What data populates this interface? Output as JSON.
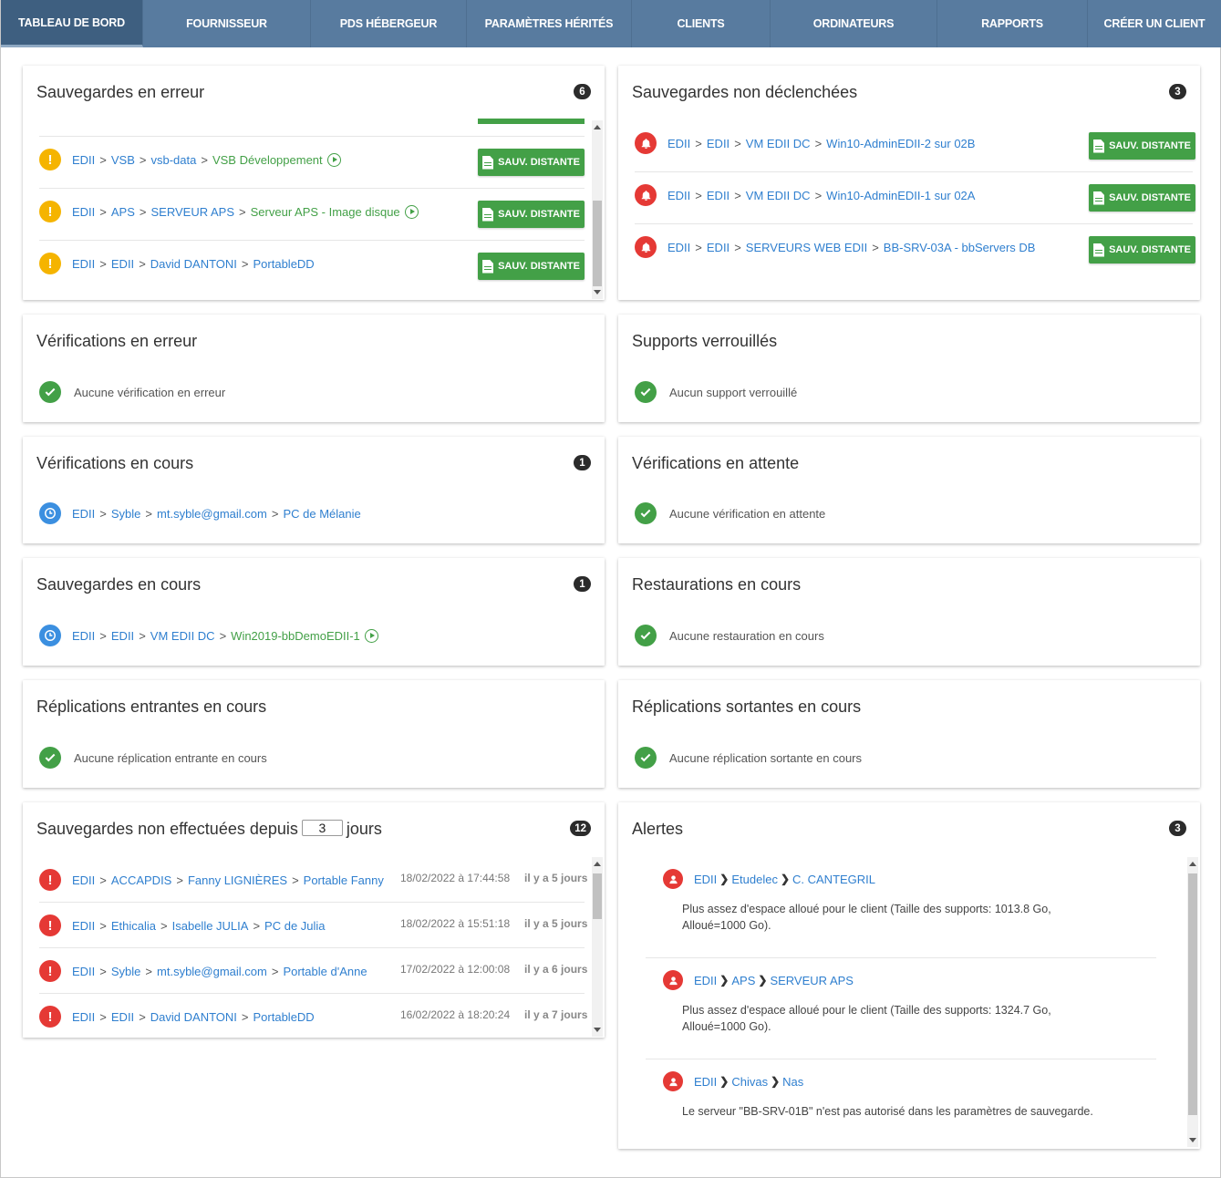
{
  "nav": {
    "tabs": [
      {
        "label": "TABLEAU DE BORD"
      },
      {
        "label": "FOURNISSEUR"
      },
      {
        "label": "PDS HÉBERGEUR"
      },
      {
        "label": "PARAMÈTRES HÉRITÉS"
      },
      {
        "label": "CLIENTS"
      },
      {
        "label": "ORDINATEURS"
      },
      {
        "label": "RAPPORTS"
      },
      {
        "label": "CRÉER UN CLIENT"
      }
    ]
  },
  "icons": {
    "warning": "warning-icon",
    "error": "error-icon",
    "ok": "check-icon",
    "clock": "clock-icon",
    "bell": "bell-icon",
    "user": "user-icon",
    "document": "document-icon",
    "play": "play-icon"
  },
  "colors": {
    "nav_bg": "#587b9f",
    "green": "#43a047",
    "red": "#e53935",
    "orange": "#f5b400",
    "blue": "#3b8fe0",
    "link": "#2f7fcf"
  },
  "sep": ">",
  "remote_button_label": "SAUV. DISTANTE",
  "backup_errors": {
    "title": "Sauvegardes en erreur",
    "count": "6",
    "rows": [
      {
        "p": [
          "EDII",
          "VSB",
          "vsb-data"
        ],
        "last": "VSB Développement"
      },
      {
        "p": [
          "EDII",
          "APS",
          "SERVEUR APS"
        ],
        "last": "Serveur APS - Image disque"
      },
      {
        "p": [
          "EDII",
          "EDII",
          "David DANTONI"
        ],
        "last": "PortableDD"
      }
    ]
  },
  "backups_not_started": {
    "title": "Sauvegardes non déclenchées",
    "count": "3",
    "rows": [
      {
        "p": [
          "EDII",
          "EDII",
          "VM EDII DC"
        ],
        "last": "Win10-AdminEDII-2 sur 02B"
      },
      {
        "p": [
          "EDII",
          "EDII",
          "VM EDII DC"
        ],
        "last": "Win10-AdminEDII-1 sur 02A"
      },
      {
        "p": [
          "EDII",
          "EDII",
          "SERVEURS WEB EDII"
        ],
        "last": "BB-SRV-03A - bbServers DB"
      }
    ]
  },
  "checks_error": {
    "title": "Vérifications en erreur",
    "empty": "Aucune vérification en erreur"
  },
  "locked_media": {
    "title": "Supports verrouillés",
    "empty": "Aucun support verrouillé"
  },
  "checks_running": {
    "title": "Vérifications en cours",
    "count": "1",
    "row": {
      "p": [
        "EDII",
        "Syble",
        "mt.syble@gmail.com"
      ],
      "last": "PC de Mélanie"
    }
  },
  "checks_pending": {
    "title": "Vérifications en attente",
    "empty": "Aucune vérification en attente"
  },
  "backups_running": {
    "title": "Sauvegardes en cours",
    "count": "1",
    "row": {
      "p": [
        "EDII",
        "EDII",
        "VM EDII DC"
      ],
      "last": "Win2019-bbDemoEDII-1"
    }
  },
  "restores_running": {
    "title": "Restaurations en cours",
    "empty": "Aucune restauration en cours"
  },
  "replications_in": {
    "title": "Réplications entrantes en cours",
    "empty": "Aucune réplication entrante en cours"
  },
  "replications_out": {
    "title": "Réplications sortantes en cours",
    "empty": "Aucune réplication sortante en cours"
  },
  "backups_missed": {
    "title_before": "Sauvegardes non effectuées depuis",
    "days": "3",
    "title_after": "jours",
    "count": "12",
    "rows": [
      {
        "p": [
          "EDII",
          "ACCAPDIS",
          "Fanny LIGNIÈRES"
        ],
        "last": "Portable Fanny",
        "date": "18/02/2022 à 17:44:58",
        "ago": "il y a 5 jours"
      },
      {
        "p": [
          "EDII",
          "Ethicalia",
          "Isabelle JULIA"
        ],
        "last": "PC de Julia",
        "date": "18/02/2022 à 15:51:18",
        "ago": "il y a 5 jours"
      },
      {
        "p": [
          "EDII",
          "Syble",
          "mt.syble@gmail.com"
        ],
        "last": "Portable d'Anne",
        "date": "17/02/2022 à 12:00:08",
        "ago": "il y a 6 jours"
      },
      {
        "p": [
          "EDII",
          "EDII",
          "David DANTONI"
        ],
        "last": "PortableDD",
        "date": "16/02/2022 à 18:20:24",
        "ago": "il y a 7 jours"
      }
    ]
  },
  "alerts": {
    "title": "Alertes",
    "count": "3",
    "items": [
      {
        "p": [
          "EDII",
          "Etudelec",
          "C. CANTEGRIL"
        ],
        "msg": "Plus assez d'espace alloué pour le client (Taille des supports: 1013.8 Go, Alloué=1000 Go)."
      },
      {
        "p": [
          "EDII",
          "APS",
          "SERVEUR APS"
        ],
        "msg": "Plus assez d'espace alloué pour le client (Taille des supports: 1324.7 Go, Alloué=1000 Go)."
      },
      {
        "p": [
          "EDII",
          "Chivas",
          "Nas"
        ],
        "msg": "Le serveur \"BB-SRV-01B\" n'est pas autorisé dans les paramètres de sauvegarde."
      }
    ]
  }
}
